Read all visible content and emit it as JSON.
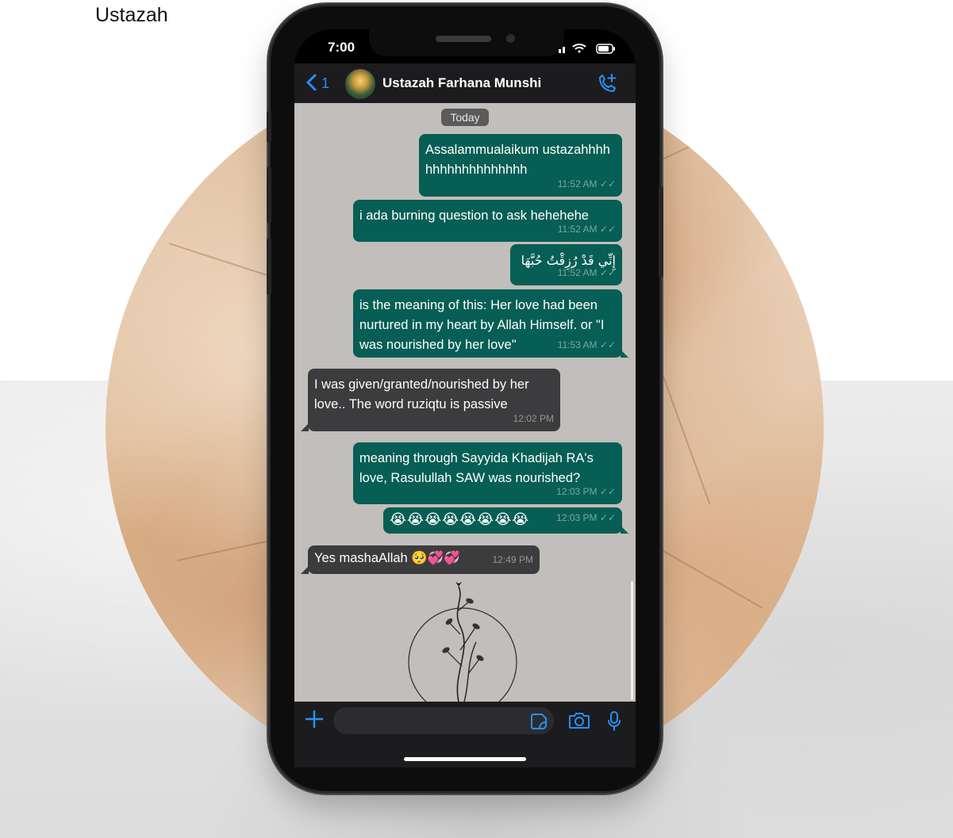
{
  "caption": {
    "line": "Ustazah"
  },
  "status_bar": {
    "time": "7:00"
  },
  "header": {
    "back_count": "1",
    "contact_name": "Ustazah Farhana Munshi"
  },
  "chat": {
    "date_label": "Today",
    "messages": [
      {
        "direction": "out",
        "text": "Assalammualaikum ustazahhhhhhhhhhhhhhhhhh",
        "time": "11:52 AM"
      },
      {
        "direction": "out",
        "text": "i ada burning question to ask hehehehe",
        "time": "11:52 AM"
      },
      {
        "direction": "out",
        "text": "إِنِّي قَدْ رُزِقْتُ حُبَّهَا",
        "time": "11:52 AM"
      },
      {
        "direction": "out",
        "text": "is the meaning of this: Her love had been nurtured in my heart by Allah Himself. or \"I was nourished by her love\"",
        "time": "11:53 AM"
      },
      {
        "direction": "in",
        "text": "I was given/granted/nourished by her love.. The word ruziqtu is passive",
        "time": "12:02 PM"
      },
      {
        "direction": "out",
        "text": "meaning through Sayyida Khadijah RA's love, Rasulullah SAW was nourished?",
        "time": "12:03 PM"
      },
      {
        "direction": "out",
        "text": "😭😭😭😭😭😭😭😭",
        "time": "12:03 PM"
      },
      {
        "direction": "in",
        "text": "Yes mashaAllah 🥺💞💞",
        "time": "12:49 PM"
      }
    ]
  },
  "input": {
    "placeholder": ""
  },
  "icons": {
    "back": "chevron-left-icon",
    "call": "add-call-icon",
    "plus": "plus-icon",
    "sticker": "sticker-icon",
    "camera": "camera-icon",
    "mic": "microphone-icon"
  },
  "colors": {
    "outgoing_bubble": "#075e54",
    "incoming_bubble": "#3c3c3e",
    "accent": "#2a8ff7",
    "chat_background": "#c1bebb"
  }
}
